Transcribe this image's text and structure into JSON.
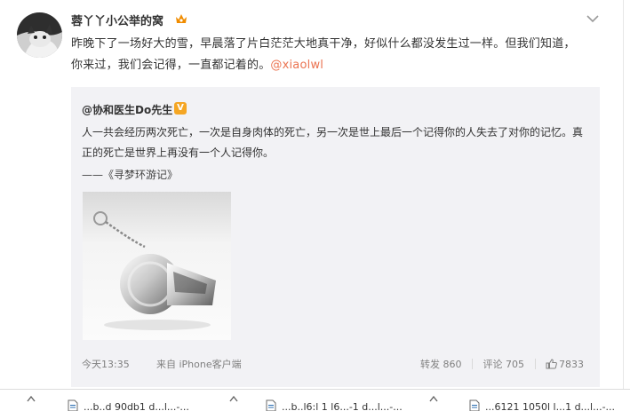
{
  "post": {
    "username": "蓉丫丫小公举的窝",
    "text_1": "昨晚下了一场好大的雪，早晨落了片白茫茫大地真干净，好似什么都没发生过一样。但我们知道，你来过，我们会记得，一直都记着的。",
    "mention": "@xiaolwl"
  },
  "repost": {
    "author": "@协和医生Do先生",
    "verified_badge": "V",
    "text": "人一共会经历两次死亡，一次是自身肉体的死亡，另一次是世上最后一个记得你的人失去了对你的记忆。真正的死亡是世界上再没有一个人记得你。",
    "citation": "——《寻梦环游记》",
    "image_icon": "whistle-photo",
    "time": "今天13:35",
    "source": "来自 iPhone客户端",
    "repost_label": "转发 860",
    "comment_label": "评论 705",
    "like_count": "7833"
  },
  "downloads": [
    {
      "name": "...b..d 90db1 d...l...-..."
    },
    {
      "name": "...b..l6:l 1 l6...-1 d...l...-..."
    },
    {
      "name": "...6121 1050l l...1 d...l...-..."
    }
  ],
  "colors": {
    "mention": "#eb7350",
    "repost_bg": "#f2f2f5",
    "badge": "#f5a623",
    "crown": "#f08c00"
  }
}
